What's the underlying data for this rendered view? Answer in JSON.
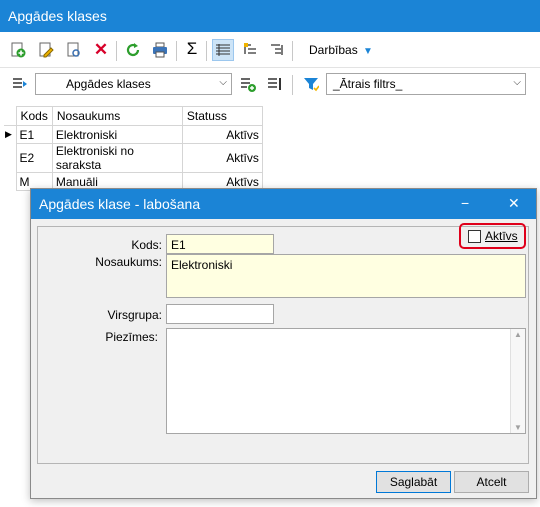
{
  "window": {
    "title": "Apgādes klases"
  },
  "toolbar": {
    "actions_label": "Darbības"
  },
  "filterbar": {
    "view_combo": "Apgādes klases",
    "quick_filter": "_Ātrais filtrs_"
  },
  "grid": {
    "columns": [
      "Kods",
      "Nosaukums",
      "Statuss"
    ],
    "rows": [
      {
        "kods": "E1",
        "nosaukums": "Elektroniski",
        "statuss": "Aktīvs"
      },
      {
        "kods": "E2",
        "nosaukums": "Elektroniski no saraksta",
        "statuss": "Aktīvs"
      },
      {
        "kods": "M",
        "nosaukums": "Manuāli",
        "statuss": "Aktīvs"
      }
    ]
  },
  "dialog": {
    "title": "Apgādes klase - labošana",
    "minimize": "−",
    "close": "✕",
    "kods_label": "Kods:",
    "kods_value": "E1",
    "aktivs_label": "Aktīvs",
    "nosaukums_label": "Nosaukums:",
    "nosaukums_value": "Elektroniski",
    "virsgrupa_label": "Virsgrupa:",
    "virsgrupa_value": "",
    "piezimes_label": "Piezīmes:",
    "piezimes_value": "",
    "save_label": "Saglabāt",
    "cancel_label": "Atcelt"
  },
  "colors": {
    "titlebar": "#1b84d6",
    "highlight": "#e0001b",
    "field_yellow": "#ffffe1"
  }
}
